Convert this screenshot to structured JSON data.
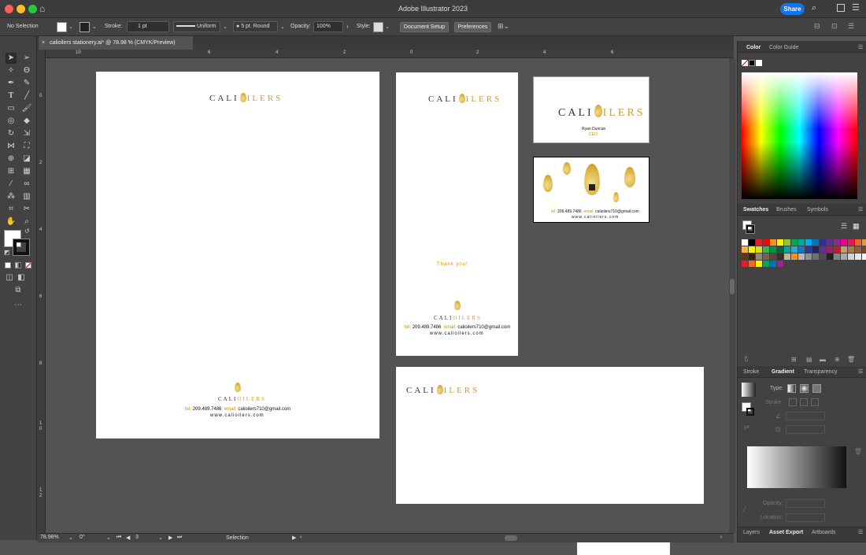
{
  "window": {
    "title": "Adobe Illustrator 2023",
    "share_label": "Share"
  },
  "control_bar": {
    "selection": "No Selection",
    "stroke_label": "Stroke:",
    "stroke_weight": "1 pt",
    "profile": "Uniform",
    "brush": "5 pt. Round",
    "opacity_label": "Opacity:",
    "opacity": "100%",
    "style_label": "Style:",
    "document_setup": "Document Setup",
    "preferences": "Preferences"
  },
  "document": {
    "tab": "calioilers stationery.ai* @ 78.98 % (CMYK/Preview)",
    "ruler_top": [
      "10",
      "6",
      "4",
      "2",
      "0",
      "2",
      "4",
      "6"
    ],
    "ruler_left": [
      "0",
      "2",
      "4",
      "6",
      "8",
      "1\n0",
      "1\n2"
    ]
  },
  "artwork": {
    "logo_left": "CALI",
    "logo_right": "ILERS",
    "name": "Ryan Duncan",
    "role": "CEO",
    "thank_you": "Thank you!",
    "tel_label": "tel:",
    "tel": "209.489.7486",
    "email_label": "email:",
    "email": "calioilers710@gmail.com",
    "website": "www.calioilers.com"
  },
  "status": {
    "zoom": "78.98%",
    "rotation": "0°",
    "artboard": "3",
    "tool": "Selection"
  },
  "panels": {
    "color_tab": "Color",
    "color_guide_tab": "Color Guide",
    "swatches_tab": "Swatches",
    "brushes_tab": "Brushes",
    "symbols_tab": "Symbols",
    "stroke_tab": "Stroke",
    "gradient_tab": "Gradient",
    "transparency_tab": "Transparency",
    "type_label": "Type:",
    "stroke_label": "Stroke:",
    "opacity_label": "Opacity:",
    "location_label": "Location:",
    "layers_tab": "Layers",
    "asset_export_tab": "Asset Export",
    "artboards_tab": "Artboards"
  },
  "colors": {
    "accent_gold": "#c8a03a",
    "share_blue": "#1473e6"
  },
  "swatch_colors": [
    "#ffffff",
    "#000000",
    "#ed1c24",
    "#ff0000",
    "#f7941d",
    "#fff200",
    "#8dc63f",
    "#00a651",
    "#00a99d",
    "#00aeef",
    "#0072bc",
    "#2e3192",
    "#662d91",
    "#92278f",
    "#ec008c",
    "#ed145b",
    "#f26522",
    "#f7941d",
    "#fbb040",
    "#fff200",
    "#d7df23",
    "#39b54a",
    "#009444",
    "#006838",
    "#00a79d",
    "#27aae1",
    "#1c75bc",
    "#2b3990",
    "#262262",
    "#662d91",
    "#9e1f63",
    "#be1e2d",
    "#c69c6d",
    "#a67c52",
    "#8c6239",
    "#754c24",
    "#603913",
    "#42210b",
    "#998675",
    "#736357",
    "#534741",
    "#362f2d",
    "#c7b299",
    "#f7941d",
    "#b8b8b8",
    "#909090",
    "#6d6e71",
    "#4d4d4f",
    "#231f20",
    "#808285",
    "#a7a9ac",
    "#d1d3d4",
    "#e6e7e8",
    "#f1f2f2",
    "#ed1c24",
    "#f26522",
    "#fff200",
    "#00a651",
    "#0072bc",
    "#92278f"
  ]
}
